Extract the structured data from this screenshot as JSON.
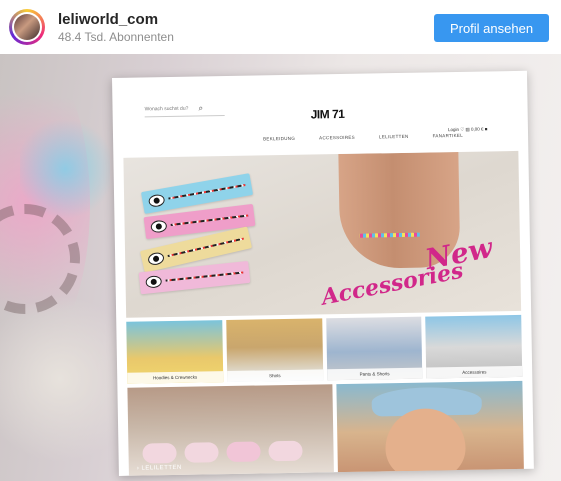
{
  "header": {
    "username": "leliworld_com",
    "followers": "48.4 Tsd. Abonnenten",
    "follow_button": "Profil ansehen"
  },
  "website": {
    "search_placeholder": "Wonach suchst du?",
    "logo": "JIM 71",
    "header_icons": "Login ♡  ▤ 0,00 €  ■",
    "nav": [
      "BEKLEIDUNG",
      "ACCESSOIRES",
      "LELILETTEN",
      "FANARTIKEL"
    ],
    "hero_text_1": "New",
    "hero_text_2": "Accessories",
    "tiles": [
      {
        "label": "Hoodies & Crewnecks"
      },
      {
        "label": "Shirts"
      },
      {
        "label": "Pants & Shorts"
      },
      {
        "label": "Accessoires"
      }
    ],
    "bottom_left_label": "LELILETTEN"
  },
  "colors": {
    "accent": "#3897f0",
    "promo_pink": "#d1278a"
  }
}
